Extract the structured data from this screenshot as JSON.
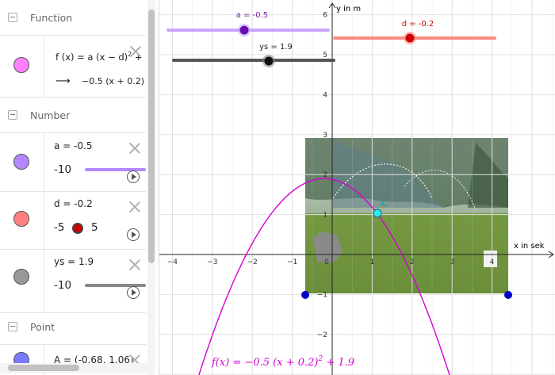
{
  "algebra": {
    "sections": {
      "function": "Function",
      "number": "Number",
      "point": "Point"
    },
    "function_item": {
      "definition_prefix": "f (x) = a  (x − d)",
      "definition_exp": "2",
      "definition_suffix": " + ",
      "result_arrow": "⟶",
      "result_text": "−0.5  (x + 0.2)",
      "color": "#ff80ff"
    },
    "number_items": [
      {
        "label": "a = -0.5",
        "min": "-10",
        "max": "",
        "color": "#b388ff",
        "track_color": "#b388ff"
      },
      {
        "label": "d = -0.2",
        "min": "-5",
        "max": "5",
        "color": "#ff8080",
        "knob_color": "#cc0000"
      },
      {
        "label": "ys = 1.9",
        "min": "-10",
        "max": "",
        "color": "#999999",
        "track_color": "#888888"
      }
    ],
    "point_item": {
      "label": "A = (-0.68, 1.06)",
      "color": "#7a7aff"
    }
  },
  "graph": {
    "y_axis_label": "y in m",
    "x_axis_label": "x in sek",
    "x_ticks": [
      "−4",
      "−3",
      "−2",
      "−1",
      "0",
      "1",
      "2",
      "3",
      "4"
    ],
    "y_ticks": [
      "6",
      "5",
      "4",
      "3",
      "2",
      "1",
      "−1",
      "−2"
    ],
    "sliders": {
      "a": {
        "label": "a = -0.5",
        "color": "#b388ff",
        "label_color": "#7b1fa2"
      },
      "d": {
        "label": "d = -0.2",
        "color": "#ff8a80",
        "label_color": "#cc0000"
      },
      "ys": {
        "label": "ys = 1.9",
        "color": "#555555",
        "label_color": "#222222"
      }
    },
    "point_c_label": "C",
    "curve_color": "#d400d4",
    "formula": {
      "lhs": "f(x)",
      "eq": " = −0.5 ",
      "paren": "(x + 0.2)",
      "exp": "2",
      "tail": " + 1.9"
    }
  }
}
